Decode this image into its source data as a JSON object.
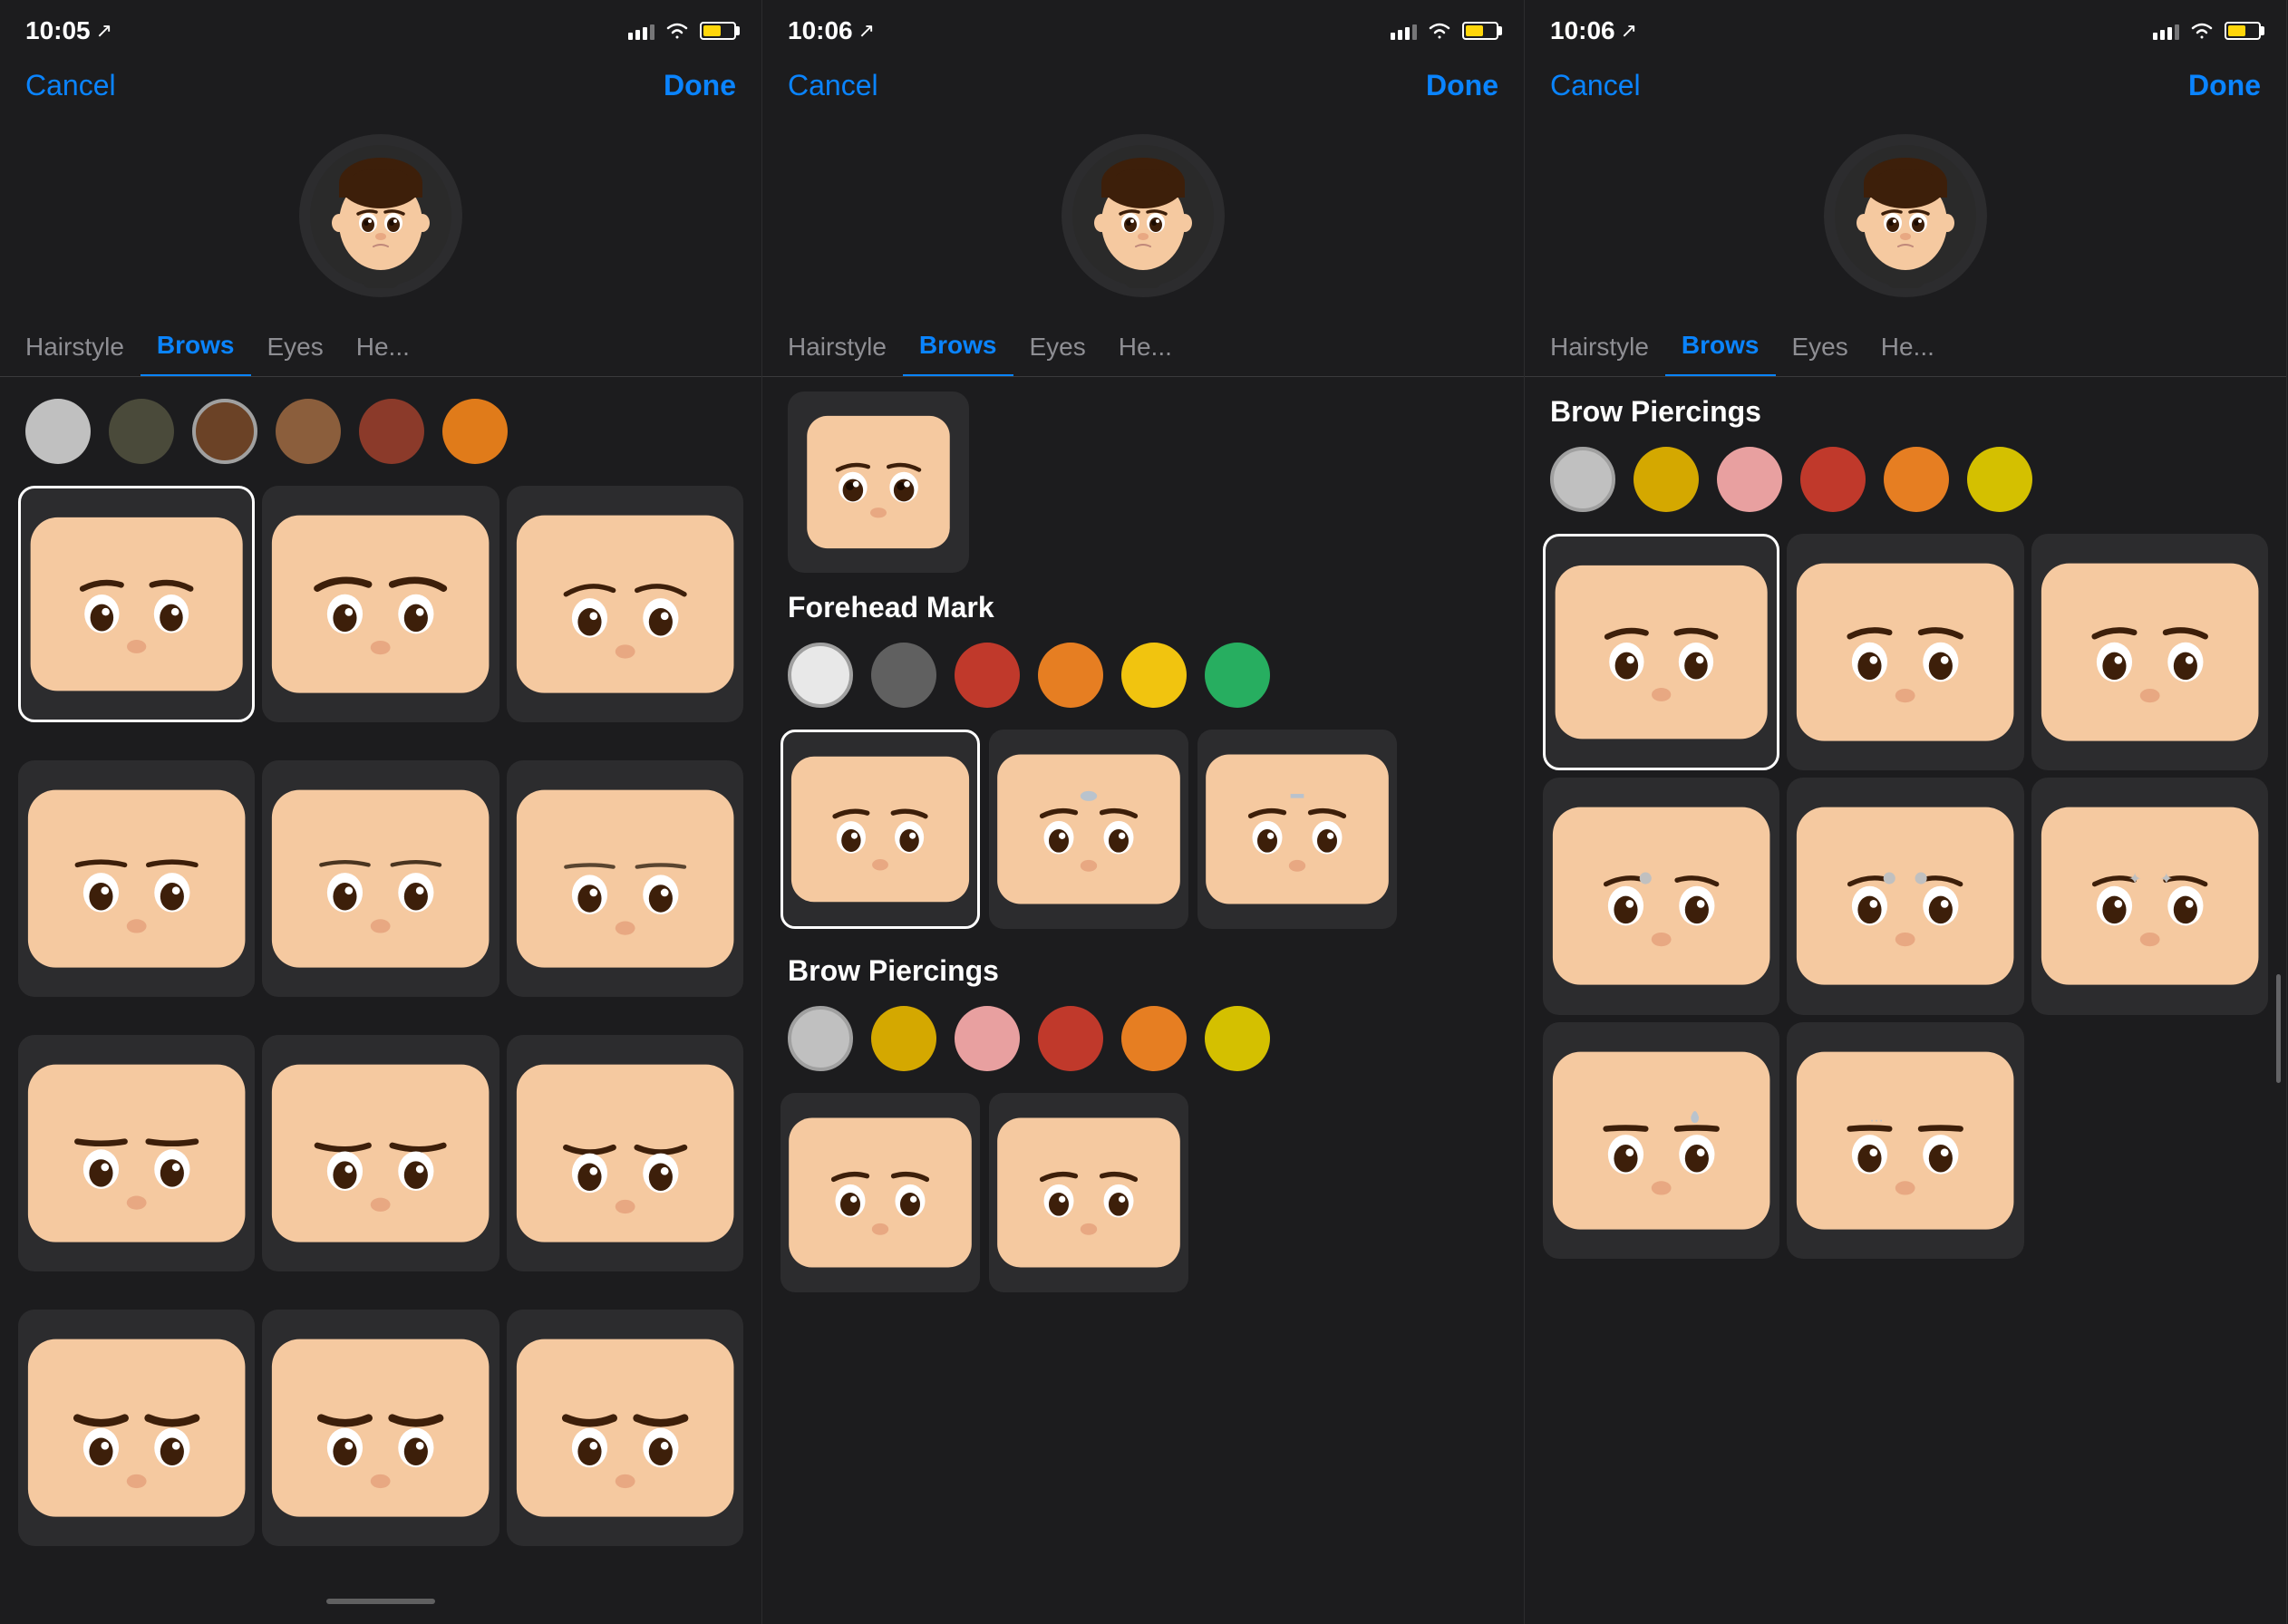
{
  "panels": [
    {
      "id": "panel1",
      "statusBar": {
        "time": "10:05",
        "hasLocation": true,
        "signalBars": [
          3,
          5,
          7,
          9,
          11
        ],
        "batteryColor": "yellow",
        "batteryLevel": 60
      },
      "nav": {
        "cancel": "Cancel",
        "done": "Done"
      },
      "tabs": [
        {
          "label": "Hairstyle",
          "active": false
        },
        {
          "label": "Brows",
          "active": true
        },
        {
          "label": "Eyes",
          "active": false
        },
        {
          "label": "He...",
          "active": false
        }
      ],
      "colorSwatches": [
        {
          "color": "#c0c0c0",
          "selected": false
        },
        {
          "color": "#4a4a3a",
          "selected": false
        },
        {
          "color": "#6b4226",
          "selected": true
        },
        {
          "color": "#8b5e3c",
          "selected": false
        },
        {
          "color": "#8b3a2a",
          "selected": false
        },
        {
          "color": "#e07b1a",
          "selected": false
        }
      ],
      "faceGrid": [
        {
          "selected": true
        },
        {
          "selected": false
        },
        {
          "selected": false
        },
        {
          "selected": false
        },
        {
          "selected": false
        },
        {
          "selected": false
        },
        {
          "selected": false
        },
        {
          "selected": false
        },
        {
          "selected": false
        },
        {
          "selected": false
        },
        {
          "selected": false
        },
        {
          "selected": false
        }
      ]
    },
    {
      "id": "panel2",
      "statusBar": {
        "time": "10:06",
        "hasLocation": true,
        "signalBars": [
          3,
          5,
          7,
          9,
          11
        ],
        "batteryColor": "yellow",
        "batteryLevel": 60
      },
      "nav": {
        "cancel": "Cancel",
        "done": "Done"
      },
      "tabs": [
        {
          "label": "Hairstyle",
          "active": false
        },
        {
          "label": "Brows",
          "active": true
        },
        {
          "label": "Eyes",
          "active": false
        },
        {
          "label": "He...",
          "active": false
        }
      ],
      "largeFacePreview": true,
      "foreheadMark": {
        "label": "Forehead Mark",
        "colors": [
          {
            "color": "#e8e8e8",
            "selected": true
          },
          {
            "color": "#606060",
            "selected": false
          },
          {
            "color": "#c0392b",
            "selected": false
          },
          {
            "color": "#e67e22",
            "selected": false
          },
          {
            "color": "#f1c40f",
            "selected": false
          },
          {
            "color": "#27ae60",
            "selected": false
          }
        ]
      },
      "foreheadFaceOptions": [
        {
          "selected": true
        },
        {
          "selected": false
        },
        {
          "selected": false
        }
      ],
      "browPiercings": {
        "label": "Brow Piercings",
        "colors": [
          {
            "color": "#c0c0c0",
            "selected": true
          },
          {
            "color": "#d4a800",
            "selected": false
          },
          {
            "color": "#e8a0a0",
            "selected": false
          },
          {
            "color": "#c0392b",
            "selected": false
          },
          {
            "color": "#e67e22",
            "selected": false
          },
          {
            "color": "#d4c000",
            "selected": false
          }
        ]
      },
      "browPiercingFaces": [
        {
          "selected": false
        },
        {
          "selected": false
        }
      ]
    },
    {
      "id": "panel3",
      "statusBar": {
        "time": "10:06",
        "hasLocation": true,
        "signalBars": [
          3,
          5,
          7,
          9,
          11
        ],
        "batteryColor": "yellow",
        "batteryLevel": 60
      },
      "nav": {
        "cancel": "Cancel",
        "done": "Done"
      },
      "tabs": [
        {
          "label": "Hairstyle",
          "active": false
        },
        {
          "label": "Brows",
          "active": true
        },
        {
          "label": "Eyes",
          "active": false
        },
        {
          "label": "He...",
          "active": false
        }
      ],
      "browPiercingsSection": {
        "label": "Brow Piercings",
        "colors": [
          {
            "color": "#c0c0c0",
            "selected": true
          },
          {
            "color": "#d4a800",
            "selected": false
          },
          {
            "color": "#e8a0a0",
            "selected": false
          },
          {
            "color": "#c0392b",
            "selected": false
          },
          {
            "color": "#e67e22",
            "selected": false
          },
          {
            "color": "#d4c000",
            "selected": false
          }
        ]
      },
      "faceGrid": [
        {
          "selected": true
        },
        {
          "selected": false
        },
        {
          "selected": false
        },
        {
          "selected": false
        },
        {
          "selected": false
        },
        {
          "selected": false
        },
        {
          "selected": false
        },
        {
          "selected": false
        },
        {
          "selected": false
        }
      ],
      "hasScrollBar": true
    }
  ],
  "icons": {
    "location": "↗",
    "wifi": "WiFi",
    "battery": "Battery"
  }
}
